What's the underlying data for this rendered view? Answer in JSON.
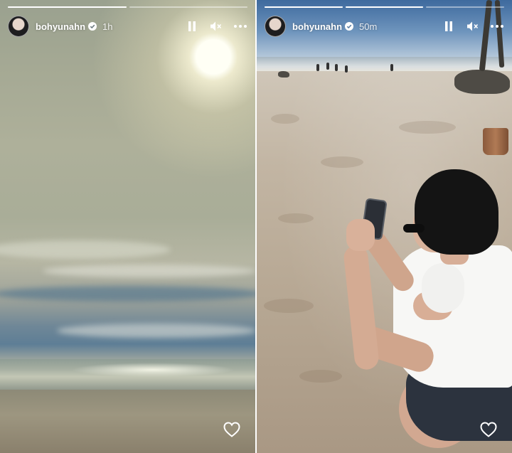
{
  "stories": [
    {
      "username": "bohyunahn",
      "time": "1h",
      "progress": [
        1.0,
        0.0
      ],
      "icons": {
        "pause": "pause-icon",
        "mute": "muted-speaker-icon",
        "more": "more-dots-icon",
        "like": "heart-icon",
        "verified": "verified-badge-icon"
      }
    },
    {
      "username": "bohyunahn",
      "time": "50m",
      "progress": [
        1.0,
        1.0,
        0.0
      ],
      "icons": {
        "pause": "pause-icon",
        "mute": "muted-speaker-icon",
        "more": "more-dots-icon",
        "like": "heart-icon",
        "verified": "verified-badge-icon"
      }
    }
  ],
  "colors": {
    "overlay_text": "#ffffff",
    "verified_badge": "#ffffff"
  }
}
